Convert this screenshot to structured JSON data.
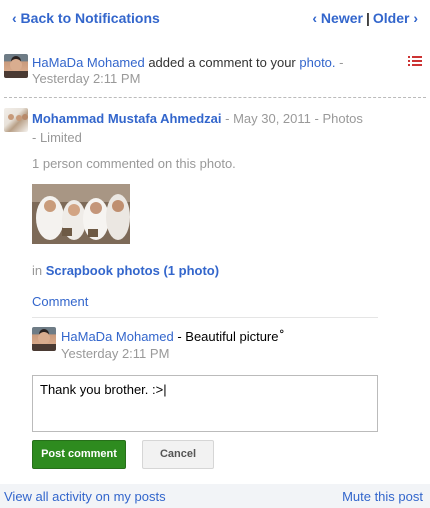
{
  "nav": {
    "back_label": "‹ Back to Notifications",
    "newer_label": "‹ Newer",
    "separator": "|",
    "older_label": "Older ›"
  },
  "notification": {
    "user": "HaMaDa Mohamed",
    "text_before_link": " added a comment to your ",
    "link": "photo.",
    "time": "Yesterday 2:11 PM",
    "dash": " - "
  },
  "post": {
    "author": "Mohammad Mustafa Ahmedzai",
    "date": "May 30, 2011",
    "category": "Photos",
    "visibility": "Limited",
    "dash": " - ",
    "commented_count_text": "1 person commented on this photo.",
    "album_prefix": "in ",
    "album_link": "Scrapbook photos (1 photo)"
  },
  "comment_link": "Comment",
  "reply": {
    "user": "HaMaDa Mohamed",
    "text": " - Beautiful picture‎ْ",
    "time": "Yesterday 2:11 PM"
  },
  "composer": {
    "value": "Thank you brother. :>|",
    "post_label": "Post comment",
    "cancel_label": "Cancel"
  },
  "footer": {
    "view_all": "View all activity on my posts",
    "mute": "Mute this post"
  },
  "colors": {
    "link": "#3366cc",
    "post_button": "#2e8b1f",
    "list_icon": "#cc3333"
  },
  "icons": {
    "notification_list": "list-icon",
    "avatar_hamada": "avatar-photo",
    "avatar_mohammad": "avatar-photo"
  }
}
